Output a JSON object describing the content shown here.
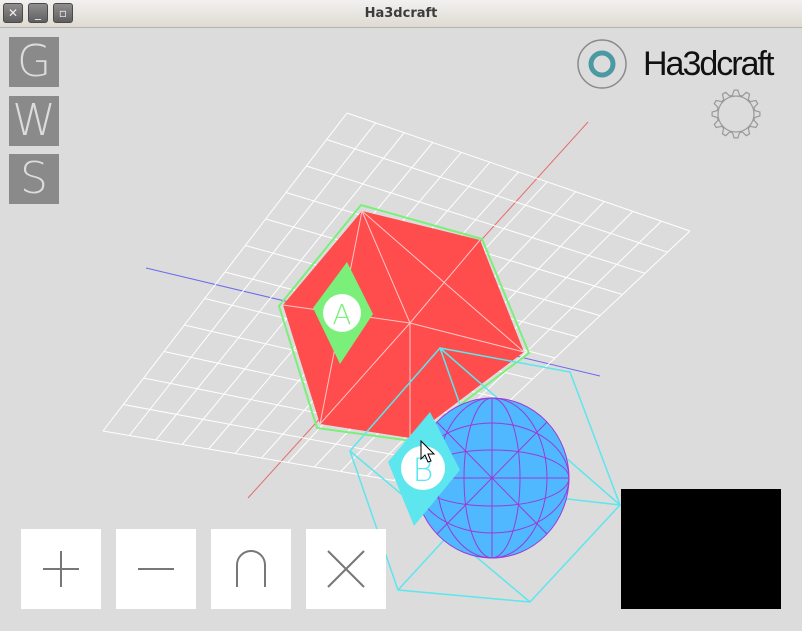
{
  "window": {
    "title": "Ha3dcraft",
    "close_icon": "close-icon",
    "minimize_icon": "minimize-icon",
    "maximize_icon": "maximize-icon"
  },
  "modes": [
    {
      "letter": "G"
    },
    {
      "letter": "W"
    },
    {
      "letter": "S"
    }
  ],
  "logo": {
    "text": "Ha3dcraft"
  },
  "operations": [
    {
      "icon": "plus-icon"
    },
    {
      "icon": "minus-icon"
    },
    {
      "icon": "intersect-icon"
    },
    {
      "icon": "multiply-icon"
    }
  ],
  "scene": {
    "labels": {
      "cube": "A",
      "sphere": "B"
    }
  },
  "colors": {
    "background": "#dcdcdc",
    "cube": "#ff4c4c",
    "cube_outline": "#7af07a",
    "sphere": "#4fb8ff",
    "sphere_lines": "#9b3bd6",
    "cyan_box": "#5de6ee",
    "grid": "#ffffff",
    "mode_button": "#8a8a8a"
  }
}
